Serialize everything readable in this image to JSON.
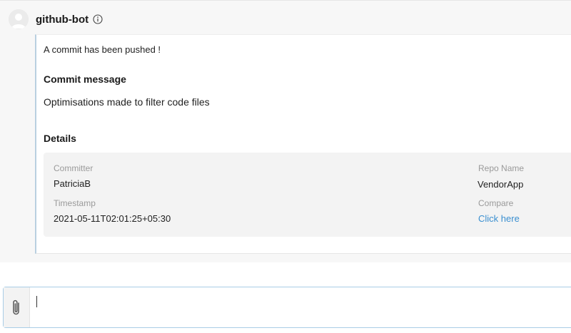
{
  "message": {
    "sender": "github-bot",
    "intro": "A commit has been pushed !",
    "commit_heading": "Commit message",
    "commit_text": "Optimisations made to filter code files",
    "details_heading": "Details",
    "details": {
      "committer_label": "Committer",
      "committer_value": "PatriciaB",
      "timestamp_label": "Timestamp",
      "timestamp_value": "2021-05-11T02:01:25+05:30",
      "repo_label": "Repo Name",
      "repo_value": "VendorApp",
      "compare_label": "Compare",
      "compare_link": "Click here"
    }
  },
  "composer": {
    "value": "",
    "placeholder": ""
  },
  "colors": {
    "link": "#3a8fd0",
    "card_accent": "#b9cfe0",
    "composer_border": "#a9cde6"
  },
  "icons": {
    "avatar": "user-avatar-icon",
    "info": "info-icon",
    "attach": "paperclip-icon"
  }
}
